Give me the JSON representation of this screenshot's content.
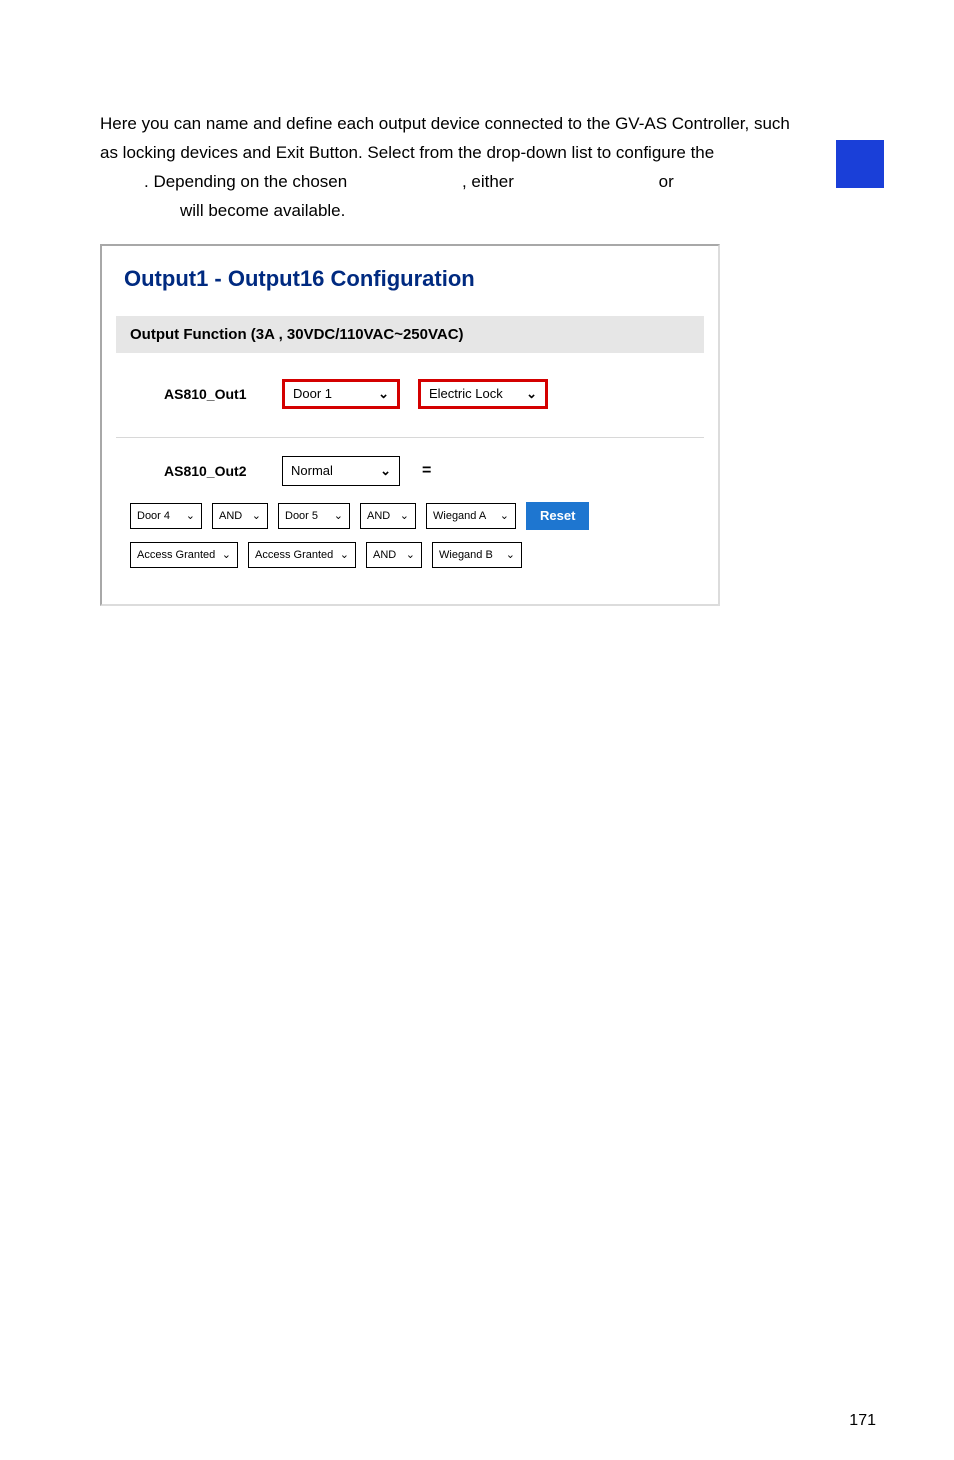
{
  "intro": {
    "line1": "Here you can name and define each output device connected to the GV-AS Controller, such",
    "line2_a": "as locking devices and Exit Button. Select from the drop-down list to configure the",
    "line3_a": ". Depending on the chosen",
    "line3_b": ", either",
    "line3_c": "or",
    "line4_a": "will become available."
  },
  "config": {
    "title": "Output1 - Output16 Configuration",
    "section_header": "Output Function (3A , 30VDC/110VAC~250VAC)",
    "output1": {
      "label": "AS810_Out1",
      "door": "Door 1",
      "func": "Electric Lock"
    },
    "output2": {
      "label": "AS810_Out2",
      "mode": "Normal",
      "eq": "=",
      "rowA": {
        "door": "Door 4",
        "op1": "AND",
        "door2": "Door 5",
        "op2": "AND",
        "wiegand": "Wiegand A"
      },
      "rowB": {
        "acc1": "Access Granted",
        "acc2": "Access Granted",
        "op3": "AND",
        "wiegand": "Wiegand B"
      },
      "reset": "Reset"
    }
  },
  "page_number": "171",
  "chevron": "⌄"
}
